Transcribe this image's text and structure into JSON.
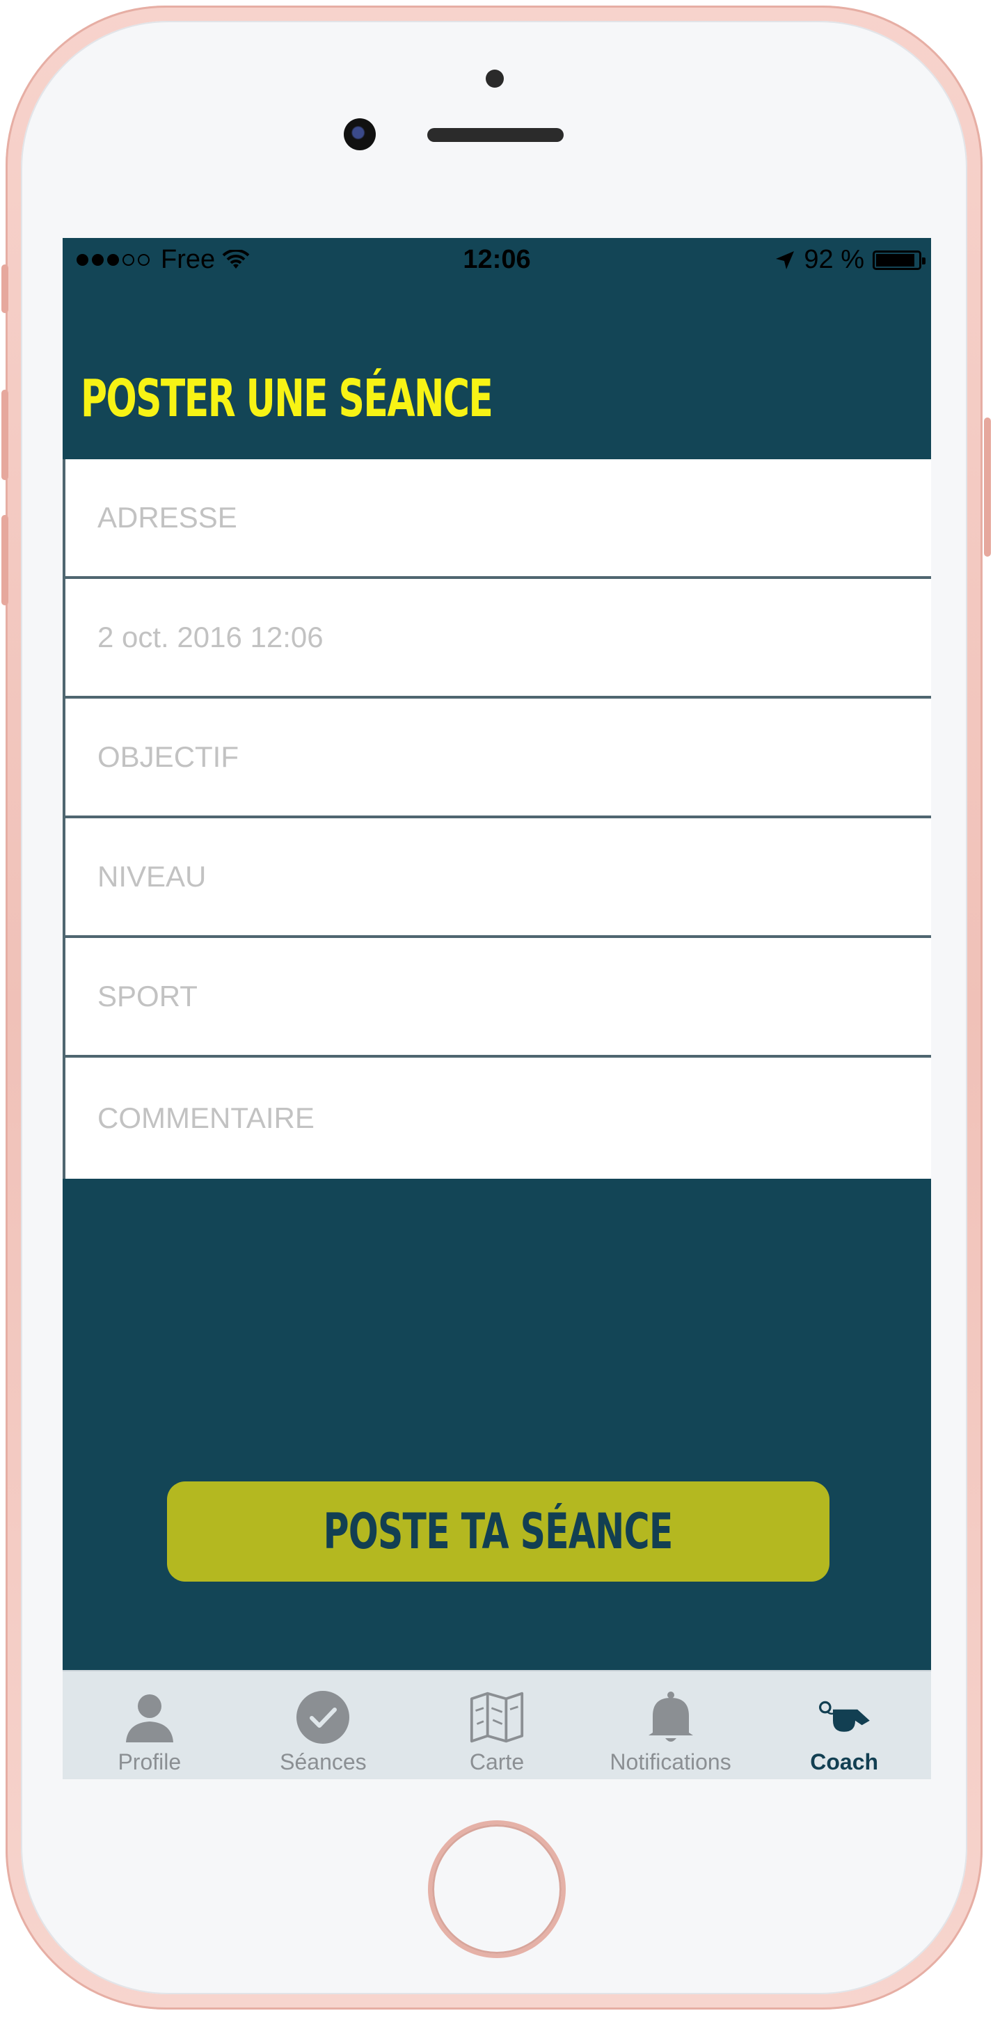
{
  "status_bar": {
    "carrier": "Free",
    "time": "12:06",
    "battery_text": "92 %",
    "battery_level": 0.92
  },
  "header": {
    "title": "POSTER UNE SÉANCE"
  },
  "form": {
    "fields": [
      {
        "placeholder": "ADRESSE",
        "value": ""
      },
      {
        "placeholder": "",
        "value": "2 oct. 2016 12:06"
      },
      {
        "placeholder": "OBJECTIF",
        "value": ""
      },
      {
        "placeholder": "NIVEAU",
        "value": ""
      },
      {
        "placeholder": "SPORT",
        "value": ""
      },
      {
        "placeholder": "COMMENTAIRE",
        "value": ""
      }
    ],
    "submit_label": "POSTE TA SÉANCE"
  },
  "tabs": [
    {
      "label": "Profile",
      "icon": "person-icon"
    },
    {
      "label": "Séances",
      "icon": "check-circle-icon"
    },
    {
      "label": "Carte",
      "icon": "map-icon"
    },
    {
      "label": "Notifications",
      "icon": "bell-icon"
    },
    {
      "label": "Coach",
      "icon": "whistle-icon",
      "active": true
    }
  ],
  "colors": {
    "screen_bg": "#134556",
    "title": "#f7f315",
    "button": "#b4b820",
    "button_text": "#123f52",
    "tab_bar": "#dfe6ea",
    "active_tab": "#123f52",
    "inactive_tab": "#8b8f93"
  }
}
